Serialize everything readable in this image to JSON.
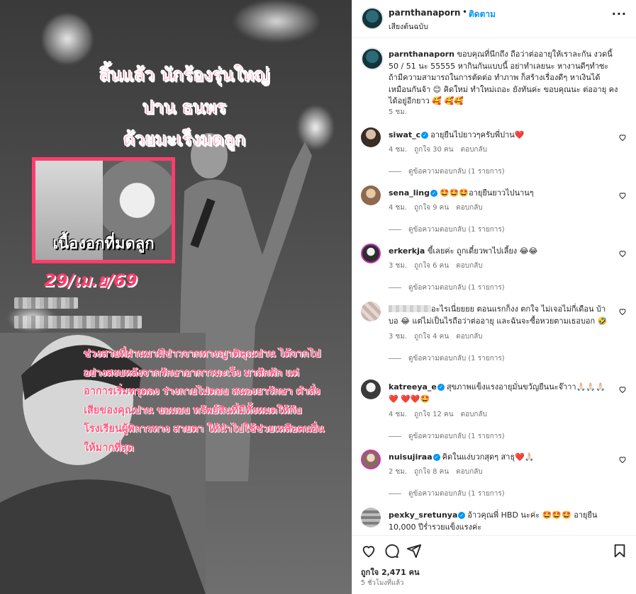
{
  "post": {
    "username": "parnthanaporn",
    "separator": "•",
    "follow_label": "ติดตาม",
    "audio_label": "เสียงต้นฉบับ",
    "more_label": "···"
  },
  "media": {
    "headline_lines": [
      "สิ้นแล้ว นักร้องรุ่นใหญ่",
      "ปาน ธนพร",
      "ด้วยมะเร็งมดลูก"
    ],
    "inset_caption": "เนื้องอกที่มดลูก",
    "date_caption": "29/เม.ย/69",
    "body_text": "ช่วงสายที่ผ่านมามีข่าวจากทางญาติคุณปาน ได้จากไปอย่างสงบหลังจากรักษาอาการมะเร็ง มาสักพัก แต่อาการเริ่มทรุดลง ร่างกายไม่ตอบ สนองยารักษา คำสั่งเสียของคุณปาน ขอมอบ ทรัพย์สินที่มีทั้งหมดให้กับโรงเรียนผู้พิการทาง สายตา ให้นำไปใช้ช่วยเหลือคนอื่นให้มากที่สุด"
  },
  "caption": {
    "username": "parnthanaporn",
    "text": " ขอบคุณที่นึกถึง ถือว่าต่ออายุให้เราละกัน งวดนี้ 50 / 51 นะ 55555 หากินกันแบบนี้ อย่าทำเลยนะ หางานดีๆทำซะ ถ้ามีความสามารถในการตัดต่อ ทำภาพ ก็สร้างเรื่องดีๆ หาเงินได้เหมือนกันจ้า 😊 คิดใหม่ ทำใหม่เถอะ ยังทันค่ะ ขอบคุณนะ ต่ออายุ คงได้อยู่อีกยาว 🥰 🥰🥰",
    "time": "5 ชม."
  },
  "comments": [
    {
      "username": "siwat_c",
      "verified": true,
      "text": "อายุยืนไปยาวๆครับพี่ปาน❤️",
      "time": "4 ชม.",
      "likes": "ถูกใจ 30 คน",
      "reply": "ตอบกลับ",
      "replies": "ดูข้อความตอบกลับ (1 รายการ)"
    },
    {
      "username": "sena_ling",
      "verified": true,
      "text": "🤩🤩🤩อายุยืนยาวไปนานๆ",
      "time": "4 ชม.",
      "likes": "ถูกใจ 9 คน",
      "reply": "ตอบกลับ",
      "replies": "ดูข้อความตอบกลับ (1 รายการ)"
    },
    {
      "username": "erkerkja",
      "verified": false,
      "text": "ขี้เลยค่ะ ถูกเดี๋ยวพาไปเลี้ยง 😂😂",
      "time": "3 ชม.",
      "likes": "ถูกใจ 6 คน",
      "reply": "ตอบกลับ",
      "replies": "ดูข้อความตอบกลับ (1 รายการ)"
    },
    {
      "username": "",
      "verified": false,
      "text": "อะไรเนี่ยยยย ตอนแรกก็งง ตกใจ ไม่เจอไม่กี่เดือน บ้าบอ 😂 แต่ไม่เป็นไรถือว่าต่ออายุ และฉันจะซื้อหวยตามเธอบอก 🤣",
      "time": "3 ชม.",
      "likes": "ถูกใจ 4 คน",
      "reply": "ตอบกลับ",
      "replies": "ดูข้อความตอบกลับ (1 รายการ)"
    },
    {
      "username": "katreeya_e",
      "verified": true,
      "text": "สุขภาพแข็งแรงอายุมั่นขวัญยืนนะจ๊าาา🙏🏻🙏🏻🙏🏻❤️ ❤️❤️🤩",
      "time": "4 ชม.",
      "likes": "ถูกใจ 12 คน",
      "reply": "ตอบกลับ",
      "replies": "ดูข้อความตอบกลับ (1 รายการ)"
    },
    {
      "username": "nuisujiraa",
      "verified": true,
      "text": "คิดในแง่บวกสุดๆ สาธุ❤️🙏🏻",
      "time": "2 ชม.",
      "likes": "ถูกใจ 8 คน",
      "reply": "ตอบกลับ",
      "replies": "ดูข้อความตอบกลับ (1 รายการ)"
    },
    {
      "username": "pexky_sretunya",
      "verified": true,
      "text": "อ้าวคุณพี่ HBD นะค่ะ 🤩🤩🤩 อายุยืน 10,000 ปีร่ำรวยแข็งแรงค่ะ",
      "time": "",
      "likes": "",
      "reply": "",
      "replies": ""
    }
  ],
  "actions": {
    "likes": "ถูกใจ 2,471 คน",
    "time_ago": "5 ชั่วโมงที่แล้ว"
  },
  "colors": {
    "accent": "#0095f6",
    "caption_pink": "#ff4f7a",
    "frame_red": "#ff3c6c"
  }
}
